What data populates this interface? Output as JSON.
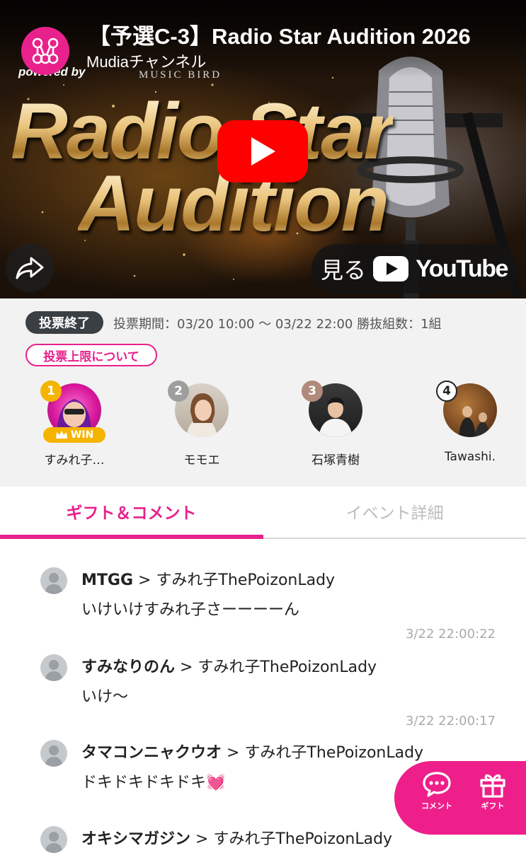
{
  "video": {
    "title": "【予選C-3】Radio Star Audition 2026",
    "channel_name": "Mudiaチャンネル",
    "powered_by": "powered by",
    "music_bird": "MUSIC BIRD",
    "thumb_line1": "Radio Star",
    "thumb_line2": "Audition",
    "watch_label": "見る",
    "youtube_label": "YouTube",
    "brand_color": "#ff0000"
  },
  "vote": {
    "status": "投票終了",
    "period": "投票期間：03/20 10:00 〜 03/22 22:00  勝抜組数：1組",
    "limit_button": "投票上限について",
    "candidates": [
      {
        "rank": "1",
        "name": "すみれ子…",
        "badge": "WIN",
        "rank_color": "#f5b400"
      },
      {
        "rank": "2",
        "name": "モモエ",
        "rank_color": "#9e9e9e"
      },
      {
        "rank": "3",
        "name": "石塚青樹",
        "rank_color": "#b08a7a"
      },
      {
        "rank": "4",
        "name": "Tawashi.",
        "rank_color": "#ffffff"
      }
    ]
  },
  "tabs": [
    {
      "label": "ギフト＆コメント",
      "active": true
    },
    {
      "label": "イベント詳細",
      "active": false
    }
  ],
  "comments": [
    {
      "user": "MTGG",
      "target": " > すみれ子ThePoizonLady",
      "text": "いけいけすみれ子さーーーーん",
      "time": "3/22 22:00:22"
    },
    {
      "user": "すみなりのん",
      "target": " > すみれ子ThePoizonLady",
      "text": "いけ〜",
      "time": "3/22 22:00:17"
    },
    {
      "user": "タマコンニャクウオ",
      "target": " > すみれ子ThePoizonLady",
      "text": "ドキドキドキドキ💓",
      "time": ""
    },
    {
      "user": "オキシマガジン",
      "target": " > すみれ子ThePoizonLady",
      "text": "",
      "time": ""
    }
  ],
  "fab": {
    "comment_label": "コメント",
    "gift_label": "ギフト"
  },
  "colors": {
    "accent": "#e8218c",
    "dark_pill": "#3a3f44"
  }
}
